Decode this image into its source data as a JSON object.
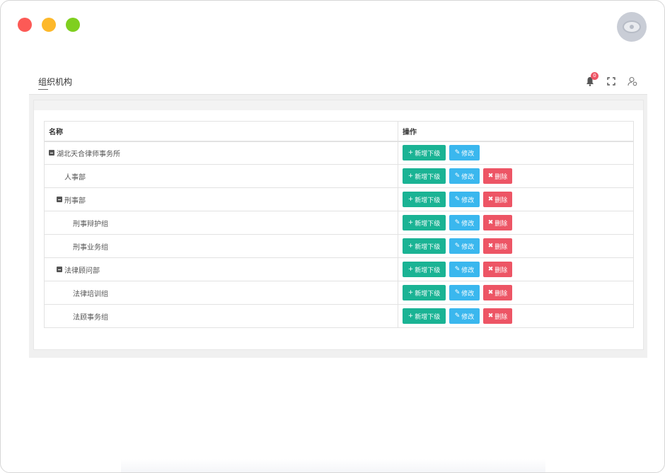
{
  "header": {
    "page_tab": "组织机构",
    "notification_count": "0"
  },
  "table": {
    "columns": [
      "名称",
      "操作"
    ],
    "buttons": {
      "add": "新增下级",
      "edit": "修改",
      "delete": "删除"
    },
    "rows": [
      {
        "label": "湖北天合律师事务所",
        "level": 0,
        "toggle": true,
        "delete": false
      },
      {
        "label": "人事部",
        "level": 1,
        "toggle": false,
        "delete": true
      },
      {
        "label": "刑事部",
        "level": 1,
        "toggle": true,
        "delete": true
      },
      {
        "label": "刑事辩护组",
        "level": 2,
        "toggle": false,
        "delete": true
      },
      {
        "label": "刑事业务组",
        "level": 2,
        "toggle": false,
        "delete": true
      },
      {
        "label": "法律顾问部",
        "level": 1,
        "toggle": true,
        "delete": true
      },
      {
        "label": "法律培训组",
        "level": 2,
        "toggle": false,
        "delete": true
      },
      {
        "label": "法顾事务组",
        "level": 2,
        "toggle": false,
        "delete": true
      }
    ]
  },
  "colors": {
    "add": "#1ab394",
    "edit": "#3ab7ee",
    "delete": "#ed5565"
  }
}
